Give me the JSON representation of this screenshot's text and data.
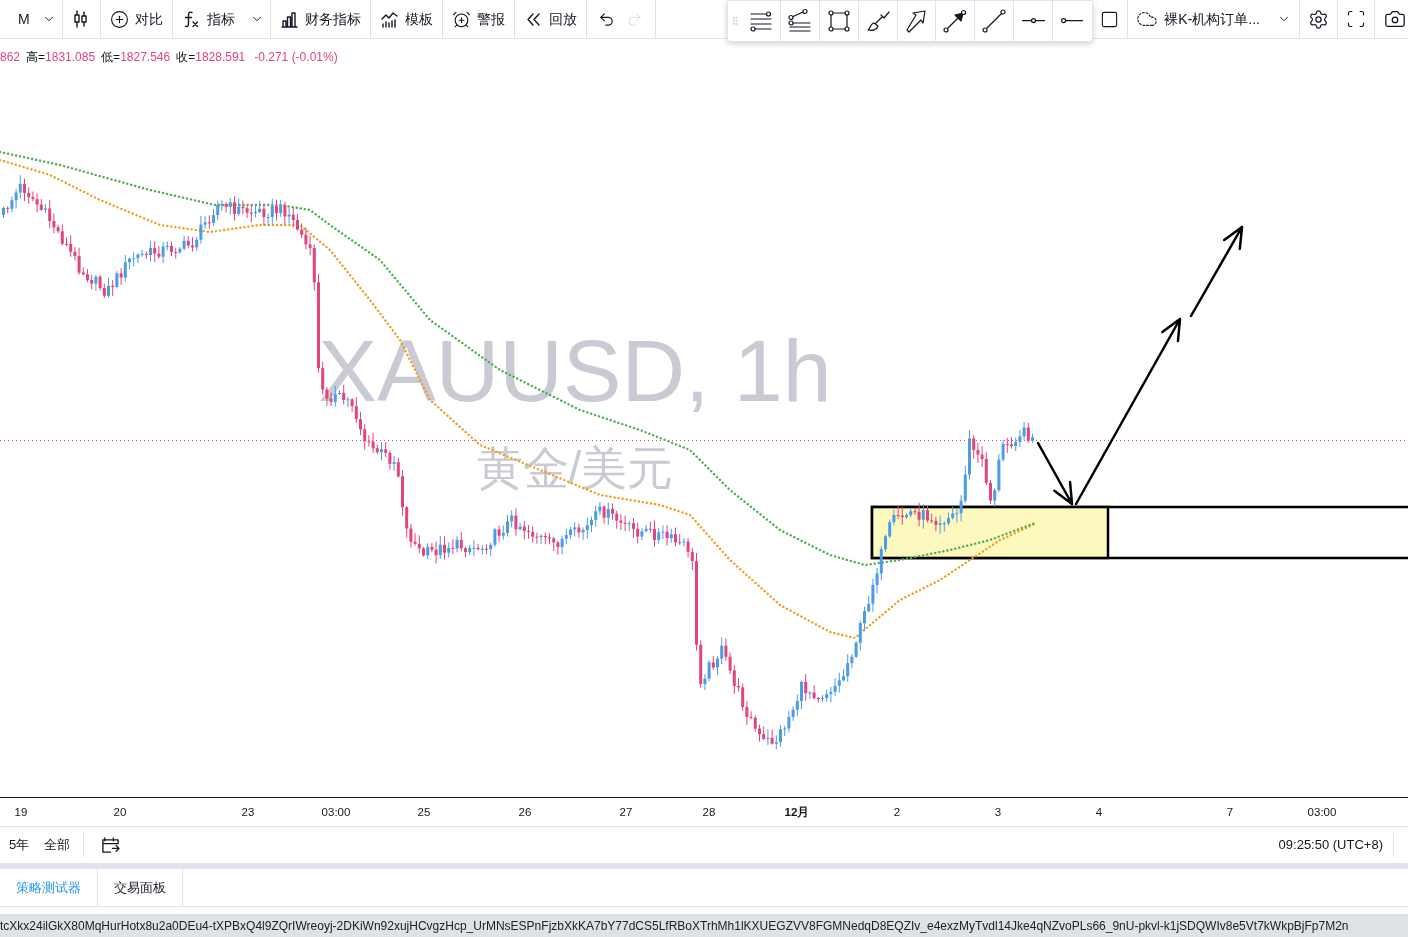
{
  "top_toolbar": {
    "interval": "M",
    "buttons": [
      {
        "kind": "compare",
        "label": "对比"
      },
      {
        "kind": "indicators",
        "label": "指标"
      },
      {
        "kind": "financials",
        "label": "财务指标"
      },
      {
        "kind": "templates",
        "label": "模板"
      },
      {
        "kind": "alerts",
        "label": "警报"
      },
      {
        "kind": "replay",
        "label": "回放"
      }
    ],
    "history": [
      {
        "kind": "undo",
        "disabled": false
      },
      {
        "kind": "redo",
        "disabled": true
      }
    ],
    "layout_name": "裸K-机构订单..."
  },
  "legend": {
    "open_tail": "862",
    "items": [
      {
        "label": "高=",
        "value": "1831.085"
      },
      {
        "label": "低=",
        "value": "1827.546"
      },
      {
        "label": "收=",
        "value": "1828.591"
      }
    ],
    "change": "-0.271 (-0.01%)"
  },
  "chart": {
    "symbol_watermark": "XAUUSD, 1h",
    "name_watermark": "黄金/美元"
  },
  "time_axis": [
    {
      "kind": "day",
      "label": "19"
    },
    {
      "kind": "day",
      "label": "20"
    },
    {
      "kind": "day",
      "label": "23"
    },
    {
      "kind": "time",
      "label": "03:00"
    },
    {
      "kind": "day",
      "label": "25"
    },
    {
      "kind": "day",
      "label": "26"
    },
    {
      "kind": "day",
      "label": "27"
    },
    {
      "kind": "day",
      "label": "28"
    },
    {
      "kind": "month",
      "label": "12月"
    },
    {
      "kind": "day",
      "label": "2"
    },
    {
      "kind": "day",
      "label": "3"
    },
    {
      "kind": "day",
      "label": "4"
    },
    {
      "kind": "day",
      "label": "7"
    },
    {
      "kind": "time",
      "label": "03:00"
    }
  ],
  "range_bar": {
    "ranges": [
      "5年",
      "全部"
    ],
    "clock": "09:25:50 (UTC+8)"
  },
  "bottom_panel": {
    "tabs": [
      {
        "label": "策略测试器",
        "selected": true
      },
      {
        "label": "交易面板",
        "selected": false
      }
    ]
  },
  "status_bar": {
    "url": "tcXkx24ilGkX80MqHurHotx8u2a0DEu4-tXPBxQ4l9ZQrIWreoyj-2DKiWn92xujHCvgzHcp_UrMNsESPnFjzbXkKA7bY77dCS5LfRBoXTrhMh1lKXUEGZVV8FGMNedqD8EQZIv_e4exzMyTvdl14Jke4qNZvoPLs66_9nU-pkvl-k1jSDQWIv8e5Vt7kWkpBjFp7M2n"
  }
}
